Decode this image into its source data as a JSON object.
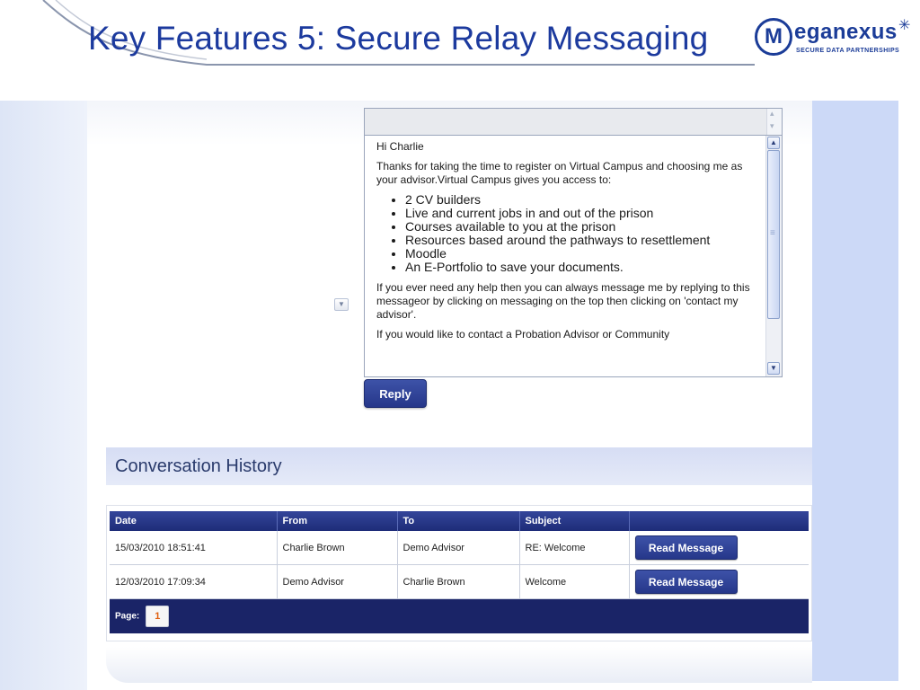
{
  "slide": {
    "title": "Key Features 5: Secure Relay Messaging"
  },
  "logo": {
    "mark": "M",
    "word": "eganexus",
    "tagline": "SECURE DATA PARTNERSHIPS"
  },
  "message": {
    "greeting": "Hi Charlie",
    "intro": "Thanks for taking the time to register on Virtual Campus and choosing me as your advisor.Virtual Campus gives you access to:",
    "bullets": [
      "2 CV builders",
      "Live and current jobs in and out of the prison",
      "Courses available to you at the prison",
      "Resources based around the pathways to resettlement",
      "Moodle",
      "An E-Portfolio to save your documents."
    ],
    "help": "If you ever need any help then you can always message me by replying to this messageor by clicking on messaging on the top then clicking on 'contact my advisor'.",
    "cutoff": "If you would like to contact a Probation Advisor or Community"
  },
  "reply_label": "Reply",
  "history": {
    "title": "Conversation History",
    "columns": [
      "Date",
      "From",
      "To",
      "Subject",
      ""
    ],
    "rows": [
      {
        "date": "15/03/2010 18:51:41",
        "from": "Charlie Brown",
        "to": "Demo Advisor",
        "subject": "RE: Welcome",
        "action": "Read Message"
      },
      {
        "date": "12/03/2010 17:09:34",
        "from": "Demo Advisor",
        "to": "Charlie Brown",
        "subject": "Welcome",
        "action": "Read Message"
      }
    ],
    "pager_label": "Page:",
    "current_page": "1"
  },
  "colors": {
    "title": "#1c3a9e",
    "button": "#2a3c90",
    "table_header": "#26378a",
    "pager_bar": "#1a2467",
    "side_panel": "#ccd9f7"
  }
}
